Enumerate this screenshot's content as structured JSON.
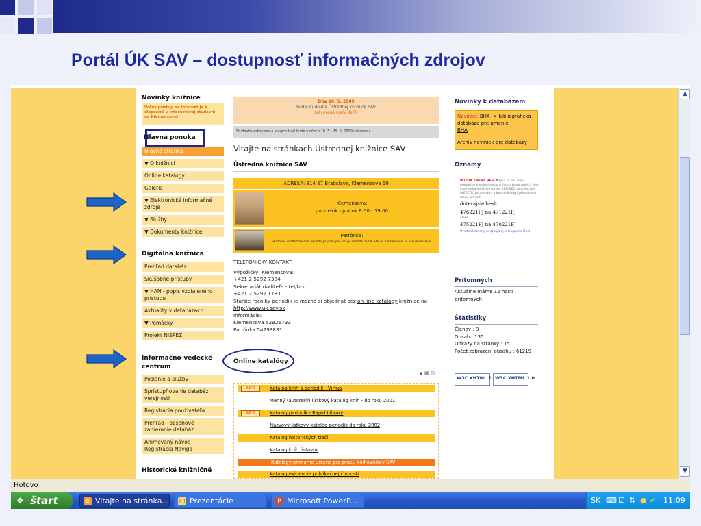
{
  "slide": {
    "title": "Portál ÚK SAV – dostupnosť informačných zdrojov",
    "colors": {
      "title": "#1c2aa0",
      "accent": "#1c2490",
      "bar": "#1e2a8c"
    }
  },
  "website": {
    "left": {
      "news_heading": "Novinky knižnice",
      "news_text": "Voľný prístup na internet je k dispozícii v internetovej študovni na Klemensovej",
      "main_heading": "Hlavná ponuka",
      "main_items": [
        "Hlavná stránka",
        "▼ O knižnici",
        "Online katalógy",
        "Galéria",
        "▼ Elektronické informačné zdroje",
        "▼ Služby",
        "▼ Dokumenty knižnice"
      ],
      "digital_heading": "Digitálna knižnica",
      "digital_items": [
        "Prehľad databáz",
        "Skúšobné prístupy",
        "▼ HAN - popis vzdialeného prístupu",
        "Aktuality v databázach",
        "▼ Pomôcky",
        "Projekt NISPEZ"
      ],
      "info_heading": "Informačno-vedecké centrum",
      "info_items": [
        "Poslanie a služby",
        "Sprístupňovanie databáz verejnosti",
        "Registrácia používateľa",
        "Prehľad - obsahové zameranie databáz",
        "Animovaný návod - Registrácia Naviga"
      ],
      "historic_heading": "Historické knižničné"
    },
    "middle": {
      "announce_date": "Dňa 20. 5. 2009",
      "announce_line": "bude študovňa Ústrednej knižnice SAV",
      "announce_closed": "zatvorená (celý deň).",
      "notice": "Študovňa rukopisov a starých tlačí bude v dňoch 18. 5 - 29. 5. 2009 zatvorená.",
      "welcome": "Vitajte na stránkach Ústrednej knižnice SAV",
      "library_title": "Ústredná knižnica SAV",
      "address": "ADRESA: 814 67 Bratislava, Klemensova 19",
      "klemensova_label": "Klemensova:",
      "klemensova_hours": "pondelok - piatok 8:00 - 19:00",
      "patronka_label": "Patrónka:",
      "patronka_note": "Študovňa dochádzajúcich periodík je prístupná len po dohode na ÚK SAV na Klemensovej ul. 19 v Bratislave.",
      "contact_heading": "TELEFONICKÝ KONTAKT:",
      "contact_loans": "Výpožičky, Klemensova:",
      "contact_phone1": "+421 2 5292 7384",
      "contact_secretary": "Sekretariát riaditeľa - tel/fax:",
      "contact_phone2": "+421 2 5292 1733",
      "contact_periodicals_a": "Staršie ročníky periodík je možné si objednať cez ",
      "contact_periodicals_link": "on-line katalógy",
      "contact_periodicals_b": " knižnice na",
      "contact_url": "http://www.uk.sav.sk",
      "info_label": "Informácie:",
      "info_klemensova": "Klemensova 52921733",
      "info_patronka": "Patrónka 54793831",
      "catalogs_heading": "Online katalógy",
      "info_badge": "INFO",
      "catalogs": [
        "Katalóg kníh a periodík - Virtua",
        "Menný (autorský) lístkový katalóg kníh - do roku 2001",
        "Katalóg periodík - Rapid Library",
        "Názvový lístkový katalóg periodík do roku 2002",
        "Katalóg historických tlačí",
        "Katalóg kníh ústavov",
        "Katalógy primárne určené pre prácu knihovníkov SAV",
        "Katalóg evidencie publikačnej činnosti"
      ]
    },
    "right": {
      "db_news_heading": "Novinky k databázam",
      "db_news_label": "Novinka:",
      "db_news_text": "BHA -> bibliografická databáza pre umenie",
      "db_news_link": "BHA",
      "db_archive": "Archív noviniek pre databázy",
      "notices_heading": "Oznamy",
      "notice_pw_title": "POZOR ZMENA HESLA",
      "notice_pw_text": "týka sa len žien: oriebežne meníme heslo u žien z tvaru prvých šesť čísel rodného čísla na tvar RRMMDD plus inicialy (VEEKTR) písmenami a bez diakritiky) príeezvisko meno príklad:",
      "notice_pw_old": "doterajsie heslo",
      "notice_pw_old_val": "476221FJ na 471221FJ",
      "notice_pw_new": "alebo",
      "notice_pw_new_val": "475221FJ na 470221FJ",
      "notice_pw_foot": "Uvedené zmeny sa týkajú aj prístupu do HAN",
      "present_heading": "Prítomných",
      "present_text": "Aktuálne máme 12 hostí prítomných",
      "stats_heading": "Štatistiky",
      "stats": [
        "Členov : 8",
        "Obsah : 135",
        "Odkazy na stránky : 15",
        "Počet zobrazení obsahu : 61219"
      ],
      "badge_xhtml": "W3C XHTML 1.0"
    }
  },
  "browser": {
    "status": "Hotovo"
  },
  "taskbar": {
    "start": "štart",
    "tasks": [
      "Vitajte na stránka...",
      "Prezentácie",
      "Microsoft PowerP..."
    ],
    "lang": "SK",
    "clock": "11:09"
  }
}
